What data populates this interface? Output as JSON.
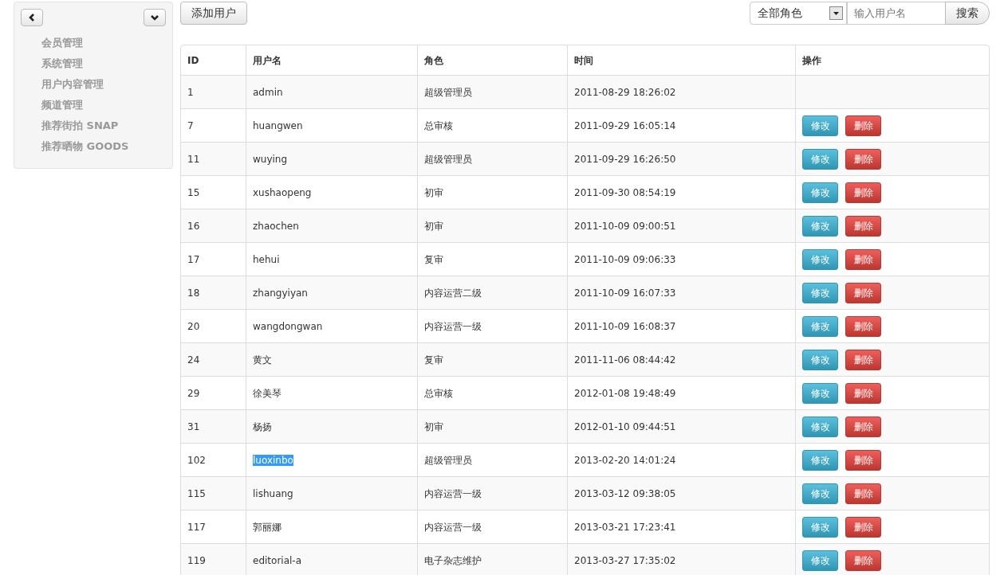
{
  "sidebar": {
    "items": [
      "会员管理",
      "系统管理",
      "用户内容管理",
      "频道管理",
      "推荐街拍 SNAP",
      "推荐晒物 GOODS"
    ]
  },
  "toolbar": {
    "add_button": "添加用户",
    "role_filter": "全部角色",
    "search": {
      "placeholder": "输入用户名"
    },
    "search_button": "搜索"
  },
  "table": {
    "columns": [
      "ID",
      "用户名",
      "角色",
      "时间",
      "操作"
    ],
    "rows": [
      {
        "id": "1",
        "username": "admin",
        "role": "超级管理员",
        "time": "2011-08-29 18:26:02",
        "highlighted": false,
        "actions": []
      },
      {
        "id": "7",
        "username": "huangwen",
        "role": "总审核",
        "time": "2011-09-29 16:05:14",
        "highlighted": false,
        "actions": [
          {
            "label": "修改",
            "kind": "edit"
          },
          {
            "label": "删除",
            "kind": "delete"
          }
        ]
      },
      {
        "id": "11",
        "username": "wuying",
        "role": "超级管理员",
        "time": "2011-09-29 16:26:50",
        "highlighted": false,
        "actions": [
          {
            "label": "修改",
            "kind": "edit"
          },
          {
            "label": "删除",
            "kind": "delete"
          }
        ]
      },
      {
        "id": "15",
        "username": "xushaopeng",
        "role": "初审",
        "time": "2011-09-30 08:54:19",
        "highlighted": false,
        "actions": [
          {
            "label": "修改",
            "kind": "edit"
          },
          {
            "label": "删除",
            "kind": "delete"
          }
        ]
      },
      {
        "id": "16",
        "username": "zhaochen",
        "role": "初审",
        "time": "2011-10-09 09:00:51",
        "highlighted": false,
        "actions": [
          {
            "label": "修改",
            "kind": "edit"
          },
          {
            "label": "删除",
            "kind": "delete"
          }
        ]
      },
      {
        "id": "17",
        "username": "hehui",
        "role": "复审",
        "time": "2011-10-09 09:06:33",
        "highlighted": false,
        "actions": [
          {
            "label": "修改",
            "kind": "edit"
          },
          {
            "label": "删除",
            "kind": "delete"
          }
        ]
      },
      {
        "id": "18",
        "username": "zhangyiyan",
        "role": "内容运营二级",
        "time": "2011-10-09 16:07:33",
        "highlighted": false,
        "actions": [
          {
            "label": "修改",
            "kind": "edit"
          },
          {
            "label": "删除",
            "kind": "delete"
          }
        ]
      },
      {
        "id": "20",
        "username": "wangdongwan",
        "role": "内容运营一级",
        "time": "2011-10-09 16:08:37",
        "highlighted": false,
        "actions": [
          {
            "label": "修改",
            "kind": "edit"
          },
          {
            "label": "删除",
            "kind": "delete"
          }
        ]
      },
      {
        "id": "24",
        "username": "黄文",
        "role": "复审",
        "time": "2011-11-06 08:44:42",
        "highlighted": false,
        "actions": [
          {
            "label": "修改",
            "kind": "edit"
          },
          {
            "label": "删除",
            "kind": "delete"
          }
        ]
      },
      {
        "id": "29",
        "username": "徐美琴",
        "role": "总审核",
        "time": "2012-01-08 19:48:49",
        "highlighted": false,
        "actions": [
          {
            "label": "修改",
            "kind": "edit"
          },
          {
            "label": "删除",
            "kind": "delete"
          }
        ]
      },
      {
        "id": "31",
        "username": "杨扬",
        "role": "初审",
        "time": "2012-01-10 09:44:51",
        "highlighted": false,
        "actions": [
          {
            "label": "修改",
            "kind": "edit"
          },
          {
            "label": "删除",
            "kind": "delete"
          }
        ]
      },
      {
        "id": "102",
        "username": "luoxinbo",
        "role": "超级管理员",
        "time": "2013-02-20 14:01:24",
        "highlighted": true,
        "actions": [
          {
            "label": "修改",
            "kind": "edit"
          },
          {
            "label": "删除",
            "kind": "delete"
          }
        ]
      },
      {
        "id": "115",
        "username": "lishuang",
        "role": "内容运营一级",
        "time": "2013-03-12 09:38:05",
        "highlighted": false,
        "actions": [
          {
            "label": "修改",
            "kind": "edit"
          },
          {
            "label": "删除",
            "kind": "delete"
          }
        ]
      },
      {
        "id": "117",
        "username": "郭丽娜",
        "role": "内容运营一级",
        "time": "2013-03-21 17:23:41",
        "highlighted": false,
        "actions": [
          {
            "label": "修改",
            "kind": "edit"
          },
          {
            "label": "删除",
            "kind": "delete"
          }
        ]
      },
      {
        "id": "119",
        "username": "editorial-a",
        "role": "电子杂志维护",
        "time": "2013-03-27 17:35:02",
        "highlighted": false,
        "actions": [
          {
            "label": "修改",
            "kind": "edit"
          },
          {
            "label": "删除",
            "kind": "delete"
          }
        ]
      }
    ]
  }
}
